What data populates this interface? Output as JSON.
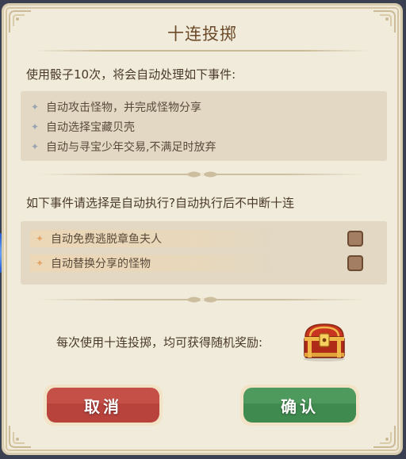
{
  "dialog": {
    "title": "十连投掷",
    "intro": "使用骰子10次，将会自动处理如下事件:",
    "auto_events": [
      {
        "label": "自动攻击怪物，并完成怪物分享"
      },
      {
        "label": "自动选择宝藏贝壳"
      },
      {
        "label": "自动与寻宝少年交易,不满足时放弃"
      }
    ],
    "question": "如下事件请选择是自动执行?自动执行后不中断十连",
    "options": [
      {
        "label": "自动免费逃脱章鱼夫人",
        "checked": false
      },
      {
        "label": "自动替换分享的怪物",
        "checked": false
      }
    ],
    "reward_text": "每次使用十连投掷，均可获得随机奖励:",
    "reward_icon": "treasure-chest-icon",
    "buttons": {
      "cancel": "取消",
      "confirm": "确认"
    }
  },
  "colors": {
    "panel": "#f1ebdb",
    "cancel_button": "#b8423c",
    "confirm_button": "#3f8a4f",
    "checkbox": "#a47e62"
  }
}
